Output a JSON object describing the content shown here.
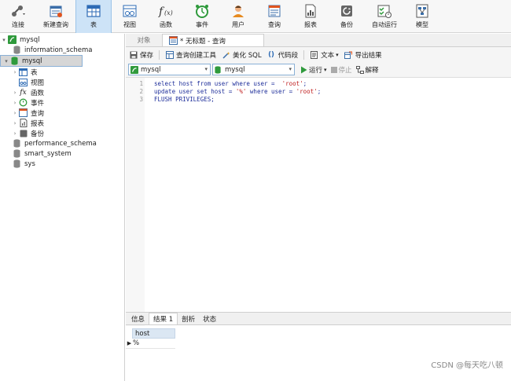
{
  "toolbar": {
    "items": [
      {
        "label": "连接",
        "icon": "connect-icon"
      },
      {
        "label": "新建查询",
        "icon": "new-query-icon"
      },
      {
        "label": "表",
        "icon": "table-icon",
        "active": true
      },
      {
        "label": "视图",
        "icon": "view-icon"
      },
      {
        "label": "函数",
        "icon": "function-icon"
      },
      {
        "label": "事件",
        "icon": "event-icon"
      },
      {
        "label": "用户",
        "icon": "user-icon"
      },
      {
        "label": "查询",
        "icon": "query-icon"
      },
      {
        "label": "报表",
        "icon": "report-icon"
      },
      {
        "label": "备份",
        "icon": "backup-icon"
      },
      {
        "label": "自动运行",
        "icon": "auto-run-icon"
      },
      {
        "label": "模型",
        "icon": "model-icon"
      }
    ]
  },
  "tree": {
    "connection": "mysql",
    "databases": [
      "information_schema",
      "mysql",
      "performance_schema",
      "smart_system",
      "sys"
    ],
    "mysql_children": [
      "表",
      "视图",
      "函数",
      "事件",
      "查询",
      "报表",
      "备份"
    ]
  },
  "tabs": {
    "objects": "对象",
    "query_tab": "* 无标题 - 查询"
  },
  "query_toolbar": {
    "save": "保存",
    "builder": "查询创建工具",
    "beautify": "美化 SQL",
    "snippet": "代码段",
    "text": "文本",
    "export": "导出结果"
  },
  "selectors": {
    "connection": "mysql",
    "database": "mysql",
    "run": "运行",
    "stop": "停止",
    "explain": "解释"
  },
  "editor": {
    "lines": [
      {
        "n": "1",
        "pre": "select host from user where user =  ",
        "str": "'root'",
        "post": ";"
      },
      {
        "n": "2",
        "pre": "update user set host = ",
        "str": "'%'",
        "post": " where user = ",
        "str2": "'root'",
        "post2": ";"
      },
      {
        "n": "3",
        "pre": "FLUSH PRIVILEGES;",
        "str": "",
        "post": ""
      }
    ]
  },
  "bottom_tabs": [
    "信息",
    "结果 1",
    "剖析",
    "状态"
  ],
  "result": {
    "column": "host",
    "rows": [
      "%"
    ]
  },
  "watermark": "CSDN @每天吃八顿",
  "colors": {
    "active_tab": "#cde3f7",
    "keyword": "#1e2e9a",
    "string": "#c02020"
  }
}
